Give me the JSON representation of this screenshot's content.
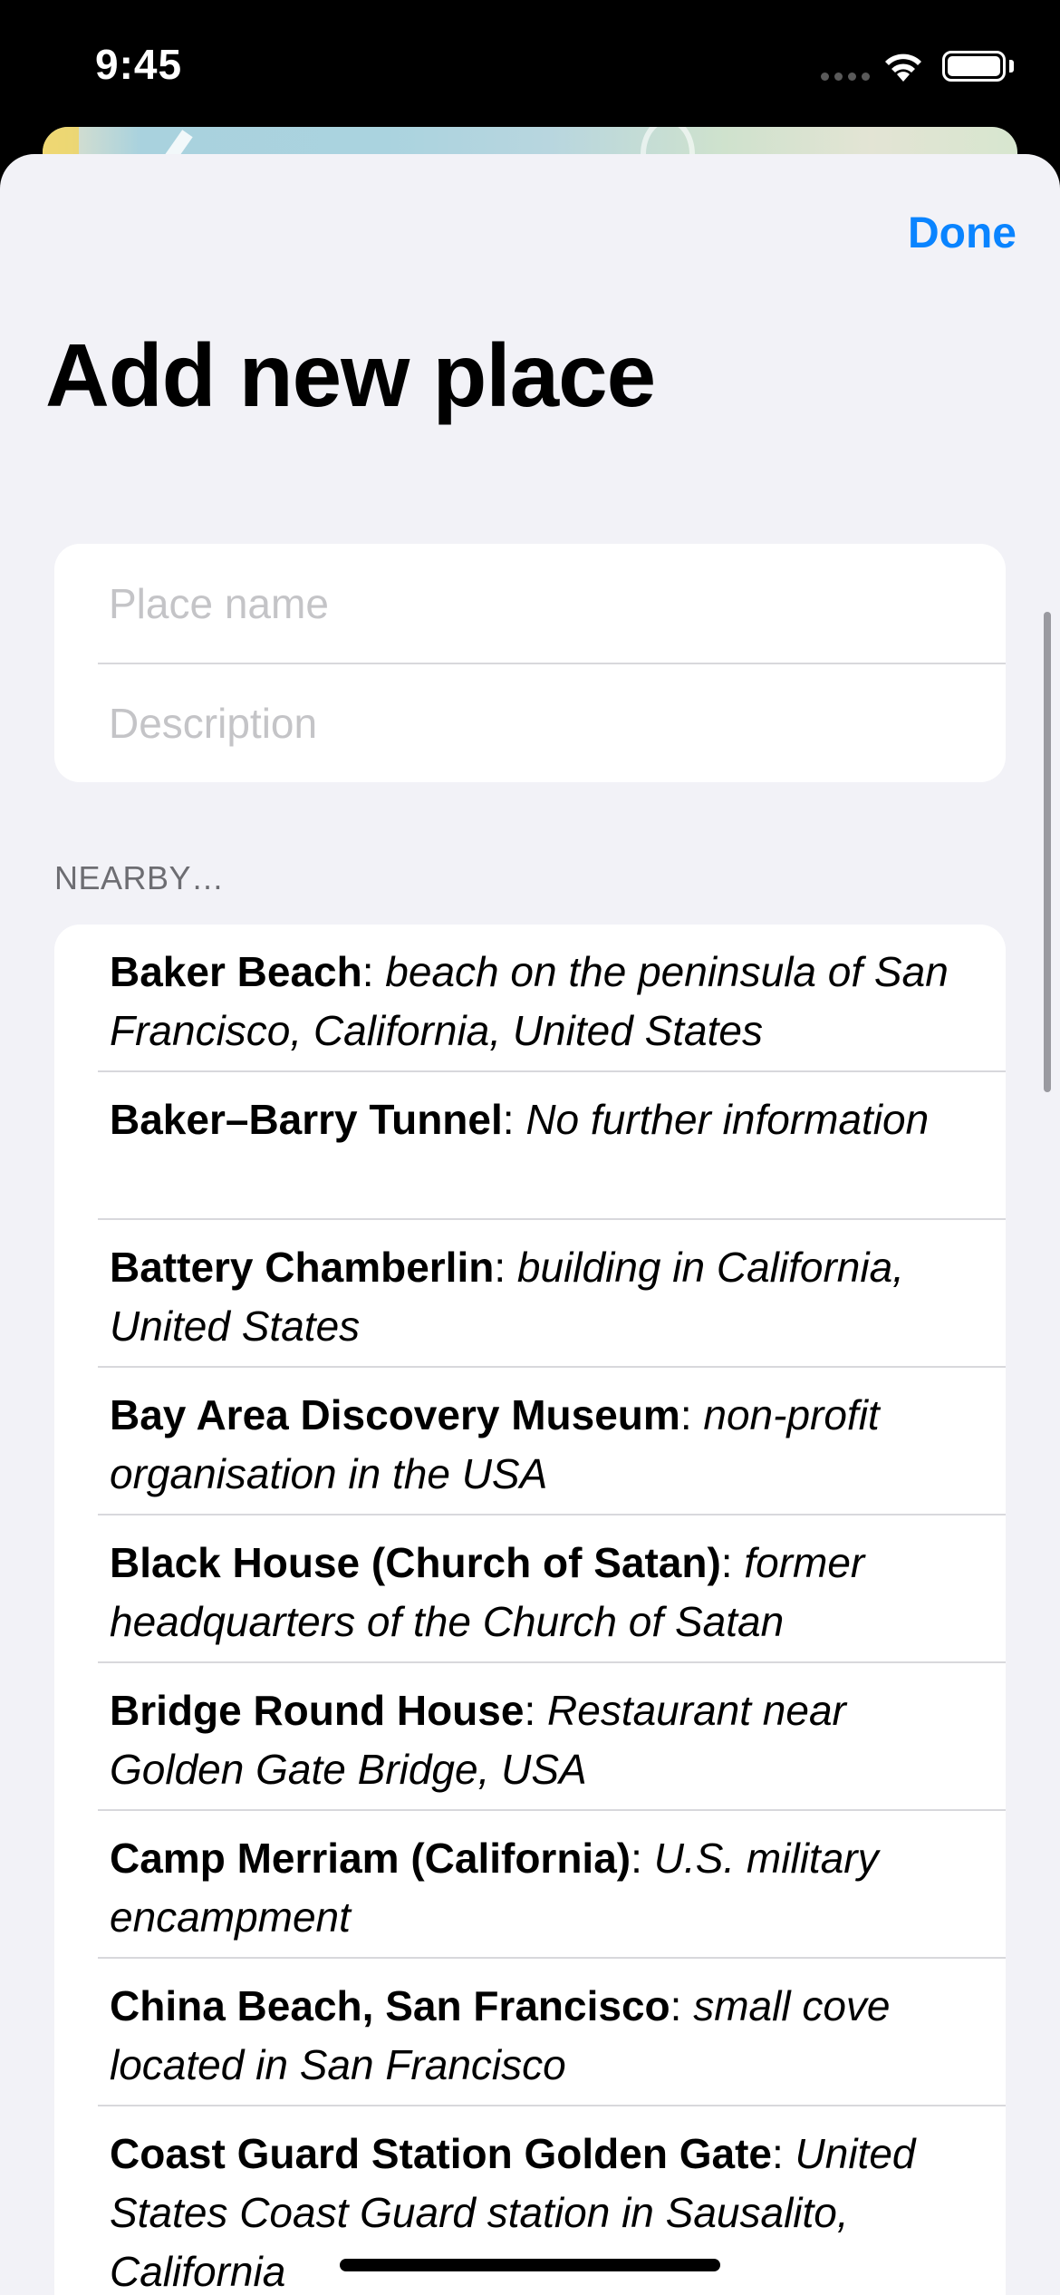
{
  "status_bar": {
    "time": "9:45"
  },
  "header": {
    "done_label": "Done",
    "title": "Add new place"
  },
  "form": {
    "place_name_placeholder": "Place name",
    "description_placeholder": "Description"
  },
  "nearby": {
    "header": "NEARBY…",
    "items": [
      {
        "name": "Baker Beach",
        "desc": "beach on the peninsula of San Francisco, California, United States"
      },
      {
        "name": "Baker–Barry Tunnel",
        "desc": "No further information"
      },
      {
        "name": "Battery Chamberlin",
        "desc": "building in California, United States"
      },
      {
        "name": "Bay Area Discovery Museum",
        "desc": "non-profit organisation in the USA"
      },
      {
        "name": "Black House (Church of Satan)",
        "desc": "former headquarters of the Church of Satan"
      },
      {
        "name": "Bridge Round House",
        "desc": "Restaurant near Golden Gate Bridge, USA"
      },
      {
        "name": "Camp Merriam (California)",
        "desc": "U.S. military encampment"
      },
      {
        "name": "China Beach, San Francisco",
        "desc": "small cove located in San Francisco"
      },
      {
        "name": "Coast Guard Station Golden Gate",
        "desc": "United States Coast Guard station in Sausalito, California"
      }
    ]
  },
  "colors": {
    "accent": "#0a84ff",
    "background": "#f2f2f7",
    "separator": "#d8d8dc"
  }
}
